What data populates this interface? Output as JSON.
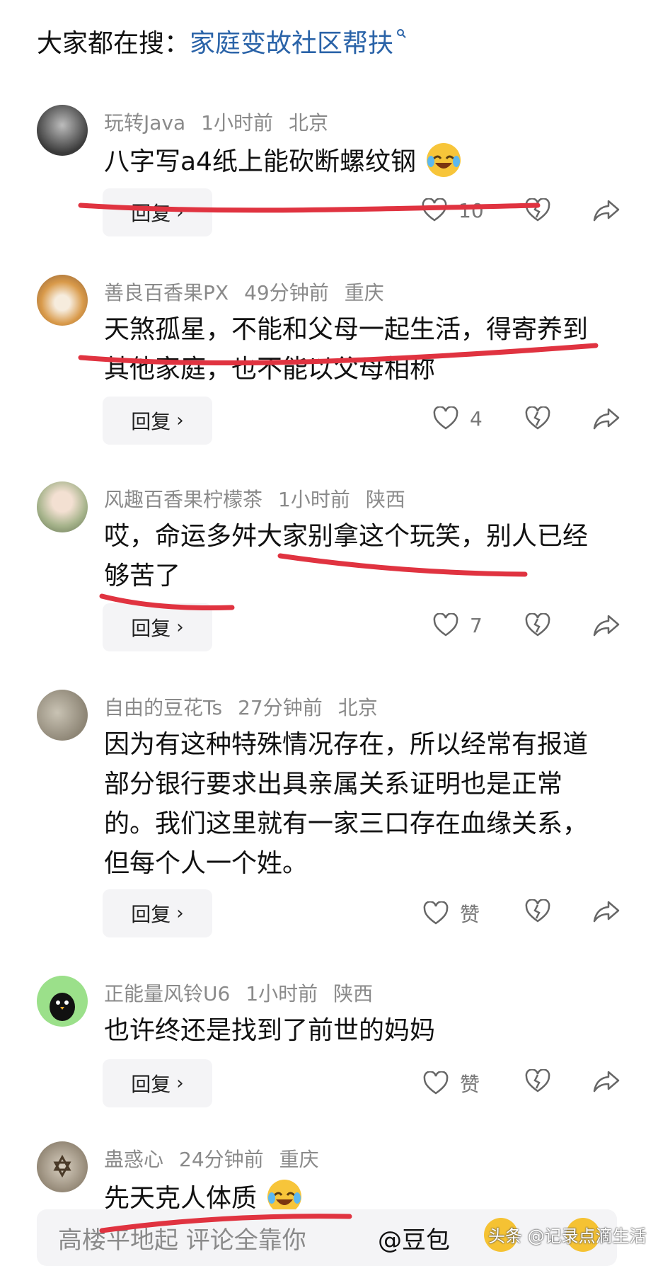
{
  "search": {
    "prefix": "大家都在搜：",
    "term": "家庭变故社区帮扶"
  },
  "colors": {
    "link": "#2a63a8",
    "meta": "#8a8a8a",
    "annotation": "#e03340"
  },
  "comments": [
    {
      "user": "玩转Java",
      "time": "1小时前",
      "location": "北京",
      "text": "八字写a4纸上能砍断螺纹钢",
      "emoji": "laughing-crying-emoji",
      "reply_label": "回复",
      "like_count": "10"
    },
    {
      "user": "善良百香果PX",
      "time": "49分钟前",
      "location": "重庆",
      "text": "天煞孤星，不能和父母一起生活，得寄养到其他家庭，也不能以父母相称",
      "reply_label": "回复",
      "like_count": "4"
    },
    {
      "user": "风趣百香果柠檬茶",
      "time": "1小时前",
      "location": "陕西",
      "text": "哎，命运多舛大家别拿这个玩笑，别人已经够苦了",
      "reply_label": "回复",
      "like_count": "7"
    },
    {
      "user": "自由的豆花Ts",
      "time": "27分钟前",
      "location": "北京",
      "text": "因为有这种特殊情况存在，所以经常有报道部分银行要求出具亲属关系证明也是正常的。我们这里就有一家三口存在血缘关系，但每个人一个姓。",
      "reply_label": "回复",
      "like_count": "赞"
    },
    {
      "user": "正能量风铃U6",
      "time": "1小时前",
      "location": "陕西",
      "text": "也许终还是找到了前世的妈妈",
      "reply_label": "回复",
      "like_count": "赞"
    },
    {
      "user": "蛊惑心",
      "time": "24分钟前",
      "location": "重庆",
      "text": "先天克人体质",
      "emoji": "laughing-crying-emoji"
    }
  ],
  "bottom_bar": {
    "placeholder": "高楼平地起  评论全靠你",
    "mention": "@豆包"
  },
  "watermark": "头条 @记录点滴生活"
}
